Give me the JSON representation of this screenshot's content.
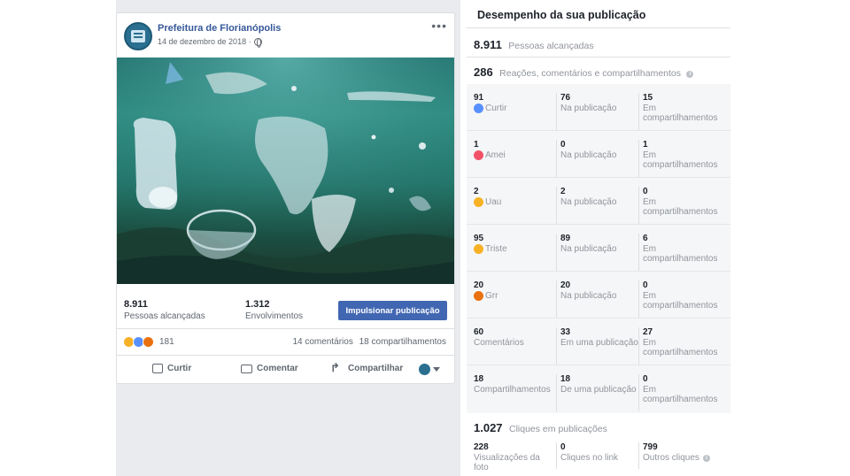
{
  "post": {
    "page_name": "Prefeitura de Florianópolis",
    "date": "14 de dezembro de 2018 ·",
    "more_icon": "more-options-icon",
    "reach_value": "8.911",
    "reach_label": "Pessoas alcançadas",
    "engagement_value": "1.312",
    "engagement_label": "Envolvimentos",
    "boost_label": "Impulsionar publicação",
    "reactions_count": "181",
    "comments_text": "14 comentários",
    "shares_text": "18 compartilhamentos",
    "like_action": "Curtir",
    "comment_action": "Comentar",
    "share_action": "Compartilhar"
  },
  "panel": {
    "title": "Desempenho da sua publicação",
    "reach_value": "8.911",
    "reach_label": "Pessoas alcançadas",
    "interactions_value": "286",
    "interactions_label": "Reações, comentários e compartilhamentos",
    "rows": [
      {
        "total": "91",
        "label": "Curtir",
        "icon": "like",
        "on_post": "76",
        "on_post_label": "Na publicação",
        "on_shares": "15",
        "on_shares_label": "Em compartilhamentos"
      },
      {
        "total": "1",
        "label": "Amei",
        "icon": "love",
        "on_post": "0",
        "on_post_label": "Na publicação",
        "on_shares": "1",
        "on_shares_label": "Em compartilhamentos"
      },
      {
        "total": "2",
        "label": "Uau",
        "icon": "wow",
        "on_post": "2",
        "on_post_label": "Na publicação",
        "on_shares": "0",
        "on_shares_label": "Em compartilhamentos"
      },
      {
        "total": "95",
        "label": "Triste",
        "icon": "sad",
        "on_post": "89",
        "on_post_label": "Na publicação",
        "on_shares": "6",
        "on_shares_label": "Em compartilhamentos"
      },
      {
        "total": "20",
        "label": "Grr",
        "icon": "angry",
        "on_post": "20",
        "on_post_label": "Na publicação",
        "on_shares": "0",
        "on_shares_label": "Em compartilhamentos"
      },
      {
        "total": "60",
        "label": "Comentários",
        "icon": "",
        "on_post": "33",
        "on_post_label": "Em uma publicação",
        "on_shares": "27",
        "on_shares_label": "Em compartilhamentos"
      },
      {
        "total": "18",
        "label": "Compartilhamentos",
        "icon": "",
        "on_post": "18",
        "on_post_label": "De uma publicação",
        "on_shares": "0",
        "on_shares_label": "Em compartilhamentos"
      }
    ],
    "clicks_value": "1.027",
    "clicks_label": "Cliques em publicações",
    "clicks": [
      {
        "value": "228",
        "label": "Visualizações da foto"
      },
      {
        "value": "0",
        "label": "Cliques no link"
      },
      {
        "value": "799",
        "label": "Outros cliques"
      }
    ]
  }
}
